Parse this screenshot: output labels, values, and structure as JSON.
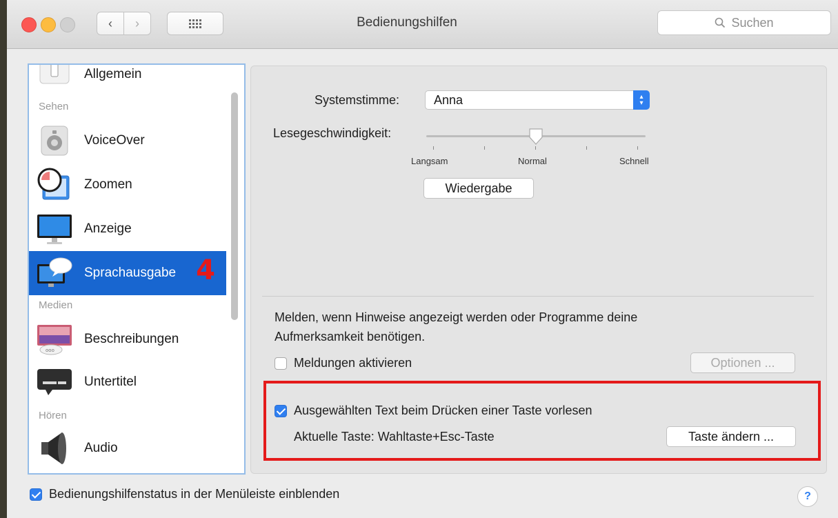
{
  "window": {
    "title": "Bedienungshilfen",
    "search_placeholder": "Suchen"
  },
  "sidebar": {
    "items": [
      {
        "label": "Allgemein",
        "icon": "switch-icon"
      },
      {
        "section": "Sehen"
      },
      {
        "label": "VoiceOver",
        "icon": "voiceover-icon"
      },
      {
        "label": "Zoomen",
        "icon": "magnifier-icon"
      },
      {
        "label": "Anzeige",
        "icon": "display-icon"
      },
      {
        "label": "Sprachausgabe",
        "icon": "speech-bubble-icon",
        "selected": true,
        "annotation": "4"
      },
      {
        "section": "Medien"
      },
      {
        "label": "Beschreibungen",
        "icon": "descriptions-icon"
      },
      {
        "label": "Untertitel",
        "icon": "captions-icon"
      },
      {
        "section": "Hören"
      },
      {
        "label": "Audio",
        "icon": "speaker-icon"
      }
    ]
  },
  "speech": {
    "voice_label": "Systemstimme:",
    "voice_value": "Anna",
    "rate_label": "Lesegeschwindigkeit:",
    "rate_slow": "Langsam",
    "rate_normal": "Normal",
    "rate_fast": "Schnell",
    "rate_value": 0.5,
    "play_button": "Wiedergabe"
  },
  "announcements": {
    "description_line1": "Melden, wenn Hinweise angezeigt werden oder Programme deine",
    "description_line2": "Aufmerksamkeit benötigen.",
    "enable_label": "Meldungen aktivieren",
    "enable_checked": false,
    "options_button": "Optionen ..."
  },
  "selected_text": {
    "checkbox_label": "Ausgewählten Text beim Drücken einer Taste vorlesen",
    "checked": true,
    "current_key_label": "Aktuelle Taste: Wahltaste+Esc-Taste",
    "change_key_button": "Taste ändern ..."
  },
  "footer": {
    "menubar_status_label": "Bedienungshilfenstatus in der Menüleiste einblenden",
    "menubar_status_checked": true,
    "help_symbol": "?"
  },
  "colors": {
    "accent": "#2f7ff0",
    "selection": "#1866d0",
    "highlight_box": "#e41a1a"
  }
}
